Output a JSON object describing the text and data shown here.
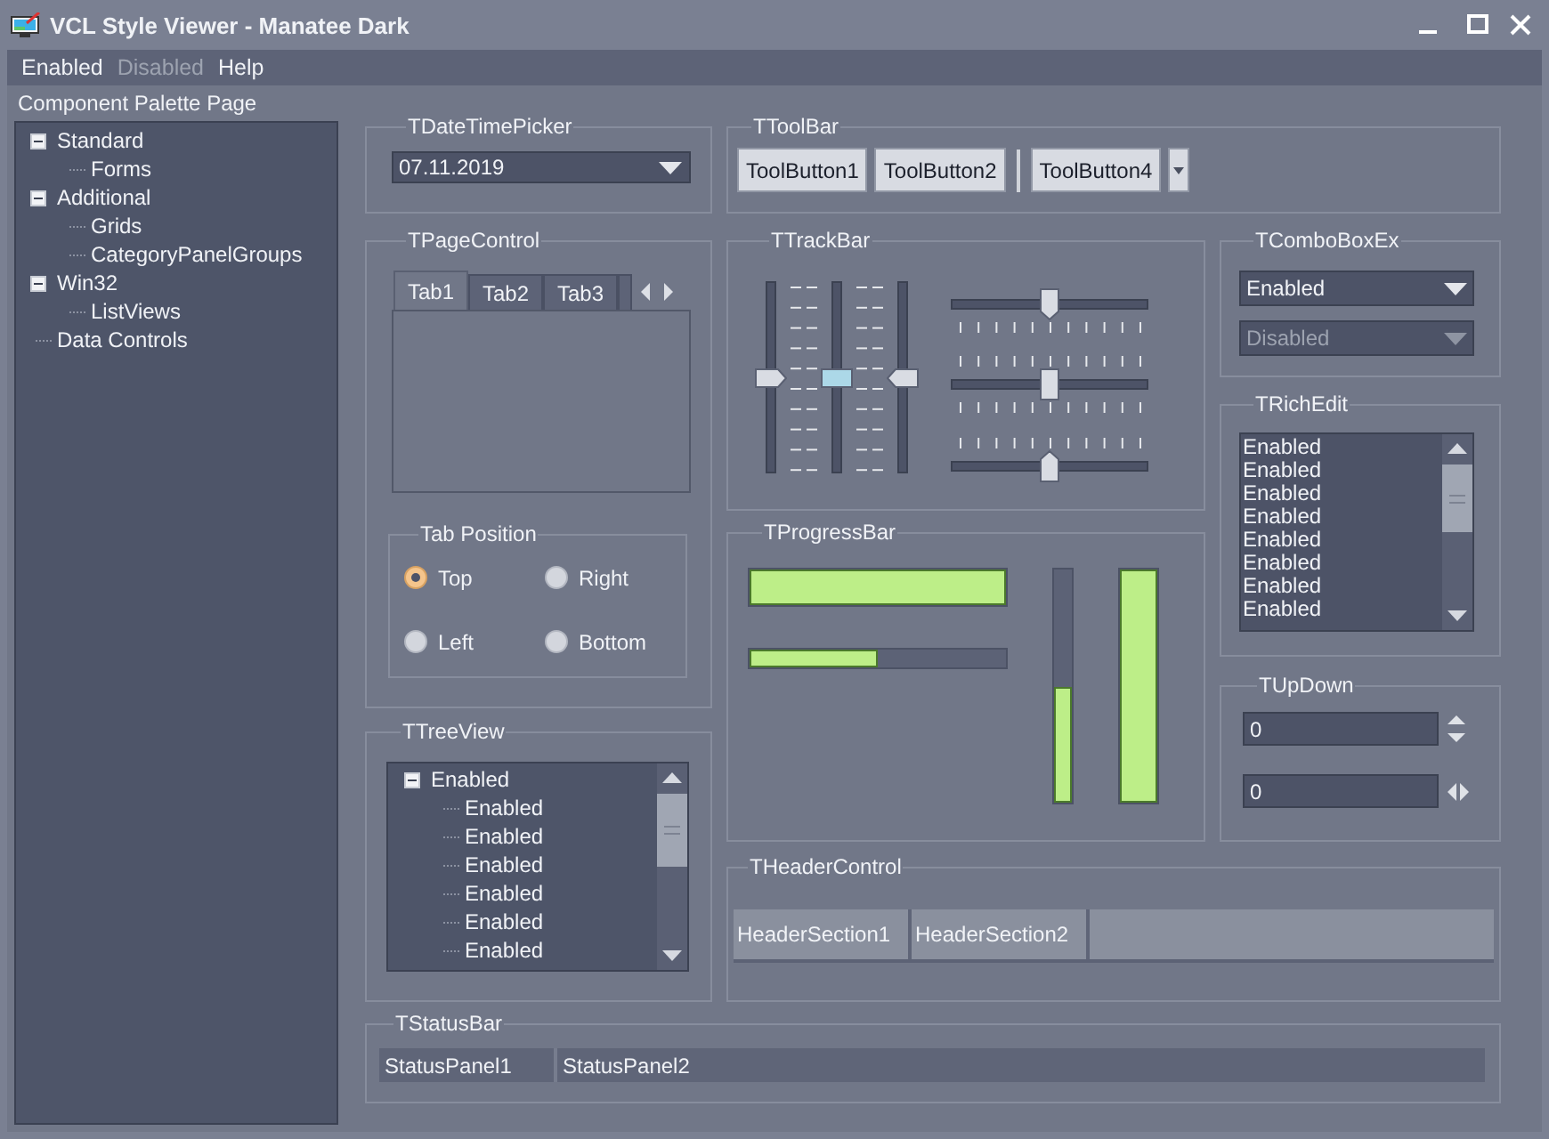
{
  "window": {
    "title": "VCL Style Viewer - Manatee Dark"
  },
  "menu": [
    {
      "label": "Enabled",
      "disabled": false
    },
    {
      "label": "Disabled",
      "disabled": true
    },
    {
      "label": "Help",
      "disabled": false
    }
  ],
  "palette": {
    "label": "Component Palette Page",
    "items": [
      {
        "label": "Standard",
        "expanded": true,
        "children": [
          {
            "label": "Forms"
          }
        ]
      },
      {
        "label": "Additional",
        "expanded": true,
        "children": [
          {
            "label": "Grids"
          },
          {
            "label": "CategoryPanelGroups"
          }
        ]
      },
      {
        "label": "Win32",
        "expanded": true,
        "children": [
          {
            "label": "ListViews"
          }
        ]
      },
      {
        "label": "Data Controls"
      }
    ]
  },
  "date_time_picker": {
    "title": "TDateTimePicker",
    "value": "07.11.2019"
  },
  "toolbar": {
    "title": "TToolBar",
    "items": [
      {
        "kind": "button",
        "label": "ToolButton1"
      },
      {
        "kind": "button",
        "label": "ToolButton2"
      },
      {
        "kind": "separator"
      },
      {
        "kind": "button",
        "label": "ToolButton4"
      },
      {
        "kind": "dropdown"
      }
    ]
  },
  "page_control": {
    "title": "TPageControl",
    "tabs": [
      {
        "label": "Tab1",
        "selected": true
      },
      {
        "label": "Tab2",
        "selected": false
      },
      {
        "label": "Tab3",
        "selected": false
      }
    ],
    "tab_position": {
      "title": "Tab Position",
      "options": [
        {
          "label": "Top",
          "selected": true
        },
        {
          "label": "Right",
          "selected": false
        },
        {
          "label": "Left",
          "selected": false
        },
        {
          "label": "Bottom",
          "selected": false
        }
      ]
    }
  },
  "track_bar": {
    "title": "TTrackBar",
    "sliders": [
      {
        "kind": "vertical",
        "ticks_before": false,
        "ticks_after": true,
        "focused": false,
        "level": 0.5
      },
      {
        "kind": "vertical",
        "ticks_before": true,
        "ticks_after": true,
        "focused": true,
        "level": 0.5
      },
      {
        "kind": "vertical",
        "ticks_before": true,
        "ticks_after": false,
        "focused": false,
        "level": 0.5
      },
      {
        "kind": "horizontal",
        "ticks_before": false,
        "ticks_after": true,
        "focused": false,
        "level": 0.5
      },
      {
        "kind": "horizontal",
        "ticks_before": true,
        "ticks_after": true,
        "focused": false,
        "level": 0.5
      },
      {
        "kind": "horizontal",
        "ticks_before": true,
        "ticks_after": false,
        "focused": false,
        "level": 0.5
      }
    ]
  },
  "combo_box_ex": {
    "title": "TComboBoxEx",
    "boxes": [
      {
        "value": "Enabled",
        "disabled": false
      },
      {
        "value": "Disabled",
        "disabled": true
      }
    ]
  },
  "rich_edit": {
    "title": "TRichEdit",
    "lines": [
      "Enabled",
      "Enabled",
      "Enabled",
      "Enabled",
      "Enabled",
      "Enabled",
      "Enabled",
      "Enabled"
    ]
  },
  "progress_bar": {
    "title": "TProgressBar",
    "bars": [
      {
        "kind": "horizontal",
        "level": 1
      },
      {
        "kind": "horizontal",
        "level": 0.5
      },
      {
        "kind": "vertical",
        "level": 0.5
      },
      {
        "kind": "vertical",
        "level": 1
      }
    ]
  },
  "up_down": {
    "title": "TUpDown",
    "fields": [
      {
        "value": "0",
        "kind": "vertical"
      },
      {
        "value": "0",
        "kind": "horizontal"
      }
    ]
  },
  "tree_view": {
    "title": "TTreeView",
    "items": [
      {
        "label": "Enabled",
        "expanded": true,
        "children": [
          {
            "label": "Enabled"
          },
          {
            "label": "Enabled"
          },
          {
            "label": "Enabled"
          },
          {
            "label": "Enabled"
          },
          {
            "label": "Enabled"
          },
          {
            "label": "Enabled"
          }
        ]
      }
    ]
  },
  "header_control": {
    "title": "THeaderControl",
    "sections": [
      "HeaderSection1",
      "HeaderSection2"
    ]
  },
  "status_bar": {
    "title": "TStatusBar",
    "panels": [
      "StatusPanel1",
      "StatusPanel2"
    ]
  }
}
